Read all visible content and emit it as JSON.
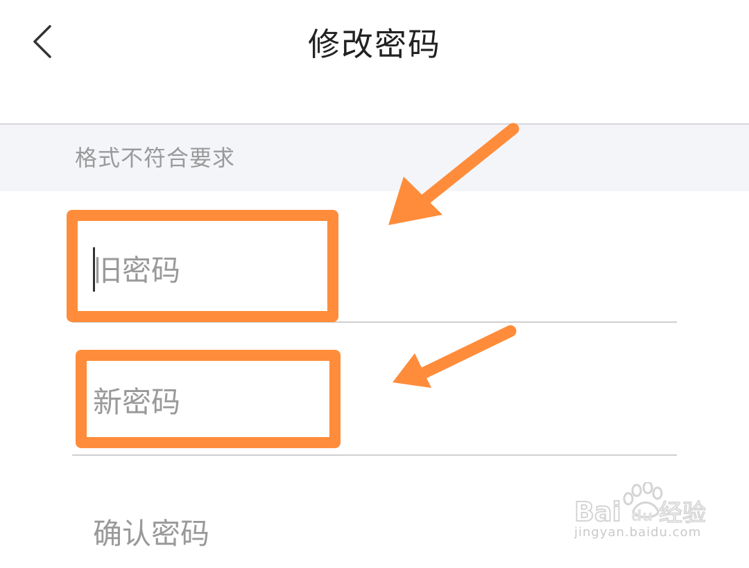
{
  "header": {
    "title": "修改密码",
    "back_icon": "chevron-left-icon"
  },
  "hint": {
    "text": "格式不符合要求"
  },
  "form": {
    "old_password": {
      "placeholder": "旧密码",
      "value": ""
    },
    "new_password": {
      "placeholder": "新密码",
      "value": ""
    },
    "confirm_password": {
      "placeholder": "确认密码",
      "value": ""
    }
  },
  "annotations": {
    "color": "#ff8c3a"
  },
  "watermark": {
    "brand": "Bai du 经验",
    "url": "jingyan.baidu.com"
  }
}
